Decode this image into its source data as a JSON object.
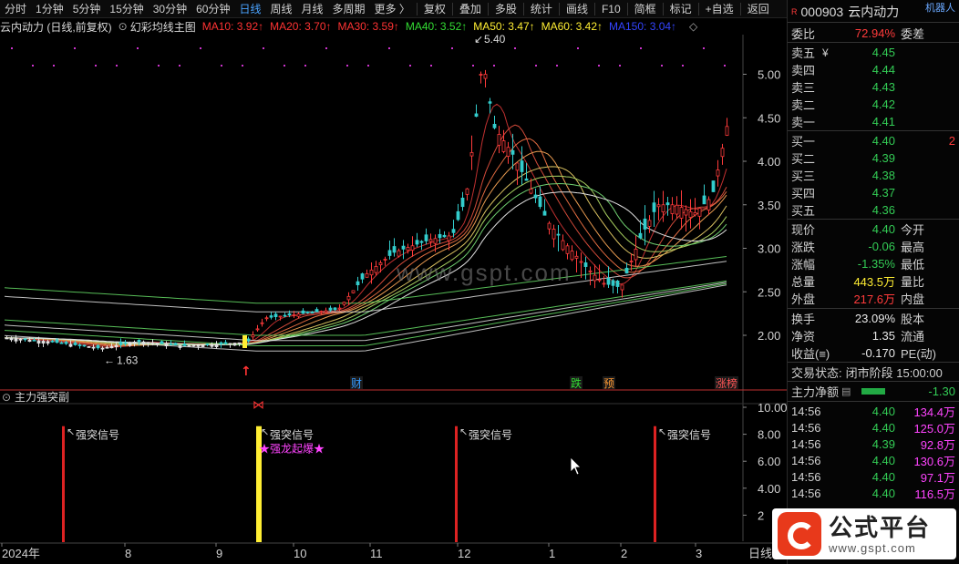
{
  "toolbar": {
    "periods": [
      "分时",
      "1分钟",
      "5分钟",
      "15分钟",
      "30分钟",
      "60分钟",
      "日线",
      "周线",
      "月线",
      "多周期",
      "更多 〉"
    ],
    "active_period": "日线",
    "tools": [
      "复权",
      "叠加",
      "多股",
      "统计",
      "画线",
      "F10",
      "简框",
      "标记",
      "+自选",
      "返回"
    ]
  },
  "legend": {
    "title": "云内动力 (日线,前复权)",
    "indicator": "幻彩均线主图",
    "ma": [
      {
        "label": "MA10: 3.92↑",
        "color": "#ff3333"
      },
      {
        "label": "MA20: 3.70↑",
        "color": "#ff3333"
      },
      {
        "label": "MA30: 3.59↑",
        "color": "#ff3333"
      },
      {
        "label": "MA40: 3.52↑",
        "color": "#33dd33"
      },
      {
        "label": "MA50: 3.47↑",
        "color": "#ffee33"
      },
      {
        "label": "MA60: 3.42↑",
        "color": "#ffee33"
      },
      {
        "label": "MA150: 3.04↑",
        "color": "#3344ff"
      }
    ]
  },
  "price_axis": [
    "5.00",
    "4.50",
    "4.00",
    "3.50",
    "3.00",
    "2.50",
    "2.00"
  ],
  "price_annotations": {
    "high": "5.40",
    "low": "1.63"
  },
  "event_markers": [
    {
      "label": "财",
      "color": "#3399ff"
    },
    {
      "label": "跌",
      "color": "#33dd33"
    },
    {
      "label": "预",
      "color": "#ff9933"
    },
    {
      "label": "涨榜",
      "color": "#ff5555"
    }
  ],
  "sub_panel": {
    "title": "主力强突副",
    "axis": [
      "10.00",
      "8.00",
      "6.00",
      "4.00",
      "2"
    ],
    "signal_label": "强突信号",
    "special_label": "★强龙起爆★"
  },
  "time_axis": [
    "2024年",
    "8",
    "9",
    "10",
    "11",
    "12",
    "1",
    "2",
    "3"
  ],
  "time_axis_right": "日线",
  "watermark_center": "www.gspt.com",
  "quote": {
    "code": "000903",
    "name": "云内动力",
    "robot": "机器人",
    "weibi_label": "委比",
    "weibi_val": "72.94%",
    "weicha_label": "委差",
    "sell": [
      {
        "label": "卖五",
        "price": "4.45"
      },
      {
        "label": "卖四",
        "price": "4.44"
      },
      {
        "label": "卖三",
        "price": "4.43"
      },
      {
        "label": "卖二",
        "price": "4.42"
      },
      {
        "label": "卖一",
        "price": "4.41"
      }
    ],
    "sell_unit": "¥",
    "buy": [
      {
        "label": "买一",
        "price": "4.40",
        "vol": "2"
      },
      {
        "label": "买二",
        "price": "4.39",
        "vol": ""
      },
      {
        "label": "买三",
        "price": "4.38",
        "vol": ""
      },
      {
        "label": "买四",
        "price": "4.37",
        "vol": ""
      },
      {
        "label": "买五",
        "price": "4.36",
        "vol": ""
      }
    ],
    "stats": [
      {
        "label": "现价",
        "val": "4.40",
        "color": "#33cc55",
        "label2": "今开"
      },
      {
        "label": "涨跌",
        "val": "-0.06",
        "color": "#33cc55",
        "label2": "最高"
      },
      {
        "label": "涨幅",
        "val": "-1.35%",
        "color": "#33cc55",
        "label2": "最低"
      },
      {
        "label": "总量",
        "val": "443.5万",
        "color": "#ffee33",
        "label2": "量比"
      },
      {
        "label": "外盘",
        "val": "217.6万",
        "color": "#ff3b3b",
        "label2": "内盘"
      }
    ],
    "stats2": [
      {
        "label": "换手",
        "val": "23.09%",
        "label2": "股本"
      },
      {
        "label": "净资",
        "val": "1.35",
        "label2": "流通"
      },
      {
        "label": "收益(≡)",
        "val": "-0.170",
        "label2": "PE(动)"
      }
    ],
    "trade_status_label": "交易状态:",
    "trade_status": "闭市阶段 15:00:00",
    "net_flow_label": "主力净额",
    "net_flow_val": "-1.30",
    "ticks": [
      {
        "time": "14:56",
        "price": "4.40",
        "vol": "134.4万"
      },
      {
        "time": "14:56",
        "price": "4.40",
        "vol": "125.0万"
      },
      {
        "time": "14:56",
        "price": "4.39",
        "vol": "92.8万"
      },
      {
        "time": "14:56",
        "price": "4.40",
        "vol": "130.6万"
      },
      {
        "time": "14:56",
        "price": "4.40",
        "vol": "97.1万"
      },
      {
        "time": "14:56",
        "price": "4.40",
        "vol": "116.5万"
      }
    ]
  },
  "brand_watermark": {
    "title": "公式平台",
    "url": "www.gspt.com"
  }
}
